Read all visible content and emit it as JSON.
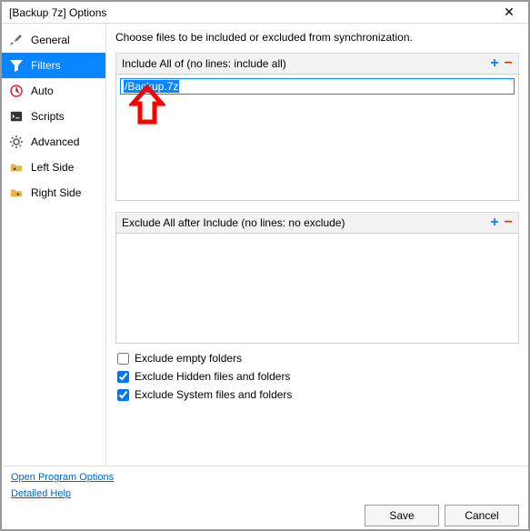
{
  "titlebar": {
    "title": "[Backup 7z] Options"
  },
  "sidebar": {
    "items": [
      {
        "label": "General"
      },
      {
        "label": "Filters"
      },
      {
        "label": "Auto"
      },
      {
        "label": "Scripts"
      },
      {
        "label": "Advanced"
      },
      {
        "label": "Left Side"
      },
      {
        "label": "Right Side"
      }
    ]
  },
  "content": {
    "description": "Choose files to be included or excluded from synchronization.",
    "include_header": "Include All of (no lines: include all)",
    "include_entry": "/Backup.7z",
    "exclude_header": "Exclude All after Include (no lines: no exclude)",
    "checks": {
      "empty": "Exclude empty folders",
      "hidden": "Exclude Hidden files and folders",
      "system": "Exclude System files and folders"
    }
  },
  "footer": {
    "link_open": "Open Program Options",
    "link_help": "Detailed Help",
    "save": "Save",
    "cancel": "Cancel"
  }
}
